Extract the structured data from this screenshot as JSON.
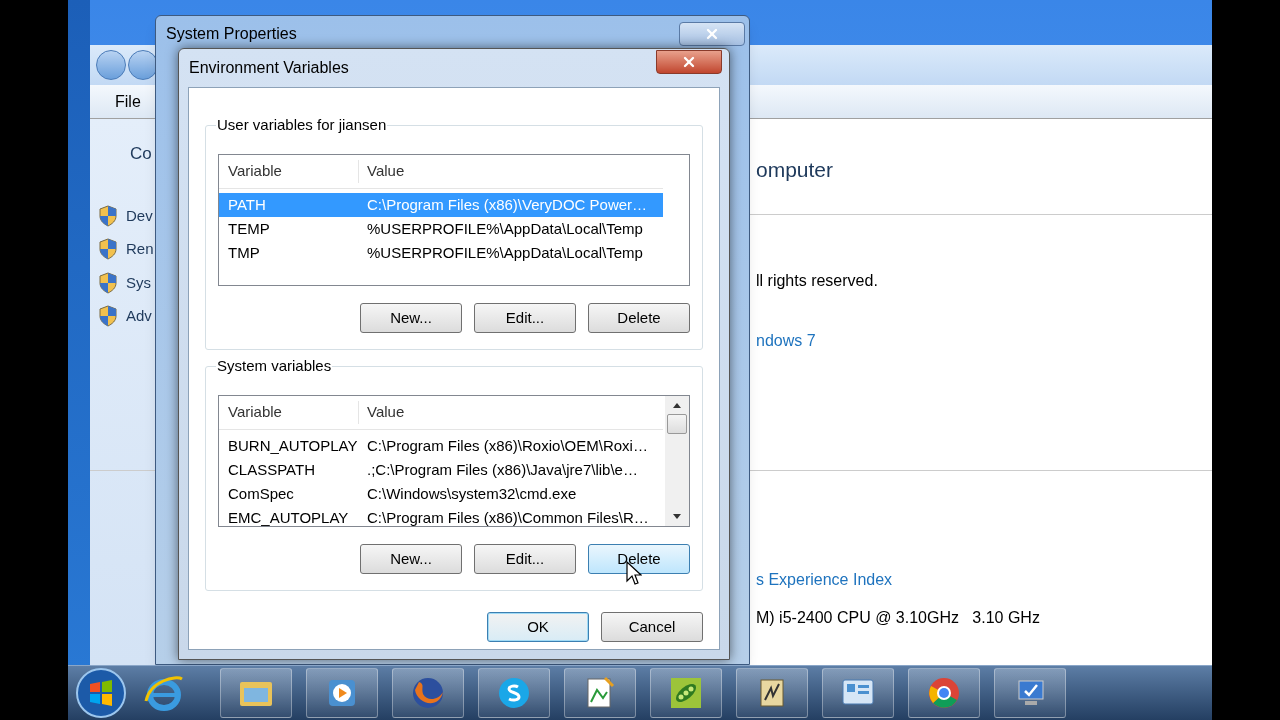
{
  "control_panel": {
    "menu": [
      "File"
    ],
    "nav_heading": "Co",
    "tasks": [
      {
        "label": "Dev"
      },
      {
        "label": "Ren"
      },
      {
        "label": "Sys"
      },
      {
        "label": "Adv"
      }
    ],
    "heading": "omputer",
    "lines": [
      {
        "kind": "text",
        "text": "ll rights reserved."
      },
      {
        "kind": "link",
        "text": "ndows 7"
      },
      {
        "kind": "link",
        "text": "s Experience Index"
      },
      {
        "kind": "text",
        "text": "M) i5-2400 CPU @ 3.10GHz   3.10 GHz"
      }
    ]
  },
  "system_properties": {
    "title": "System Properties"
  },
  "environment_variables": {
    "title": "Environment Variables",
    "groups": [
      {
        "label": "User variables for jiansen",
        "columns": [
          "Variable",
          "Value"
        ],
        "rows": [
          {
            "variable": "PATH",
            "value": "C:\\Program Files (x86)\\VeryDOC Power…",
            "selected": true
          },
          {
            "variable": "TEMP",
            "value": "%USERPROFILE%\\AppData\\Local\\Temp",
            "selected": false
          },
          {
            "variable": "TMP",
            "value": "%USERPROFILE%\\AppData\\Local\\Temp",
            "selected": false
          }
        ],
        "buttons": [
          {
            "label": "New...",
            "hovered": false
          },
          {
            "label": "Edit...",
            "hovered": false
          },
          {
            "label": "Delete",
            "hovered": false
          }
        ]
      },
      {
        "label": "System variables",
        "columns": [
          "Variable",
          "Value"
        ],
        "rows": [
          {
            "variable": "BURN_AUTOPLAY",
            "value": "C:\\Program Files (x86)\\Roxio\\OEM\\Roxi…",
            "selected": false
          },
          {
            "variable": "CLASSPATH",
            "value": ".;C:\\Program Files (x86)\\Java\\jre7\\lib\\e…",
            "selected": false
          },
          {
            "variable": "ComSpec",
            "value": "C:\\Windows\\system32\\cmd.exe",
            "selected": false
          },
          {
            "variable": "EMC_AUTOPLAY",
            "value": "C:\\Program Files (x86)\\Common Files\\R…",
            "selected": false
          }
        ],
        "buttons": [
          {
            "label": "New...",
            "hovered": false
          },
          {
            "label": "Edit...",
            "hovered": false
          },
          {
            "label": "Delete",
            "hovered": true
          }
        ]
      }
    ],
    "buttons": [
      {
        "label": "OK",
        "default": true
      },
      {
        "label": "Cancel",
        "default": false
      }
    ]
  }
}
